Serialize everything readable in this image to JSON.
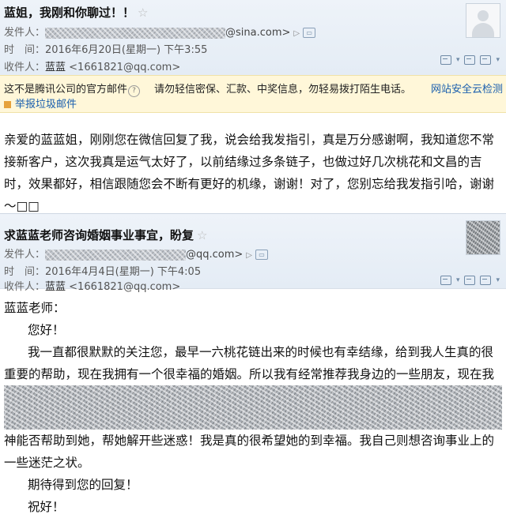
{
  "mail1": {
    "subject": "蓝姐，我刚和你聊过！！",
    "sender_label": "发件人：",
    "sender_domain": "@sina.com>",
    "time_label": "时　间：",
    "time_value": "2016年6月20日(星期一) 下午3:55",
    "recipient_label": "收件人：",
    "recipient_name": "蓝蓝",
    "recipient_addr": "<1661821@qq.com>",
    "warning_text": "这不是腾讯公司的官方邮件",
    "warning_tip": "请勿轻信密保、汇款、中奖信息，勿轻易拨打陌生电话。",
    "warning_link": "网站安全云检测",
    "report_link": "举报垃圾邮件",
    "body_lines": [
      "亲爱的蓝蓝姐，刚刚您在微信回复了我，说会给我发指引，真是万分感谢啊，我知道您不常",
      "接新客户，这次我真是运气太好了，以前结缘过多条链子，也做过好几次桃花和文昌的吉",
      "时，效果都好，相信跟随您会不断有更好的机缘，谢谢！对了，您别忘给我发指引哈，谢谢",
      "～□□"
    ]
  },
  "mail2": {
    "subject": "求蓝蓝老师咨询婚姻事业事宜，盼复",
    "sender_label": "发件人：",
    "sender_domain": "@qq.com>",
    "time_label": "时　间：",
    "time_value": "2016年4月4日(星期一) 下午4:05",
    "recipient_label": "收件人：",
    "recipient_name": "蓝蓝",
    "recipient_addr": "<1661821@qq.com>",
    "greeting": "蓝蓝老师：",
    "hello": "您好！",
    "para1_l1": "我一直都很默默的关注您，最早一六桃花链出来的时候也有幸结缘，给到我人生真的很",
    "para1_l2": "重要的帮助，现在我拥有一个很幸福的婚姻。所以我有经常推荐我身边的一些朋友，现在我",
    "para1_l3": "神能否帮助到她，帮她解开些迷惑！我是真的很希望她的到幸福。我自己则想咨询事业上的",
    "para1_l4": "一些迷茫之状。",
    "closing1": "期待得到您的回复！",
    "closing2": "祝好！"
  },
  "icons": {
    "star": "☆",
    "chevron": "▷",
    "help": "?"
  }
}
